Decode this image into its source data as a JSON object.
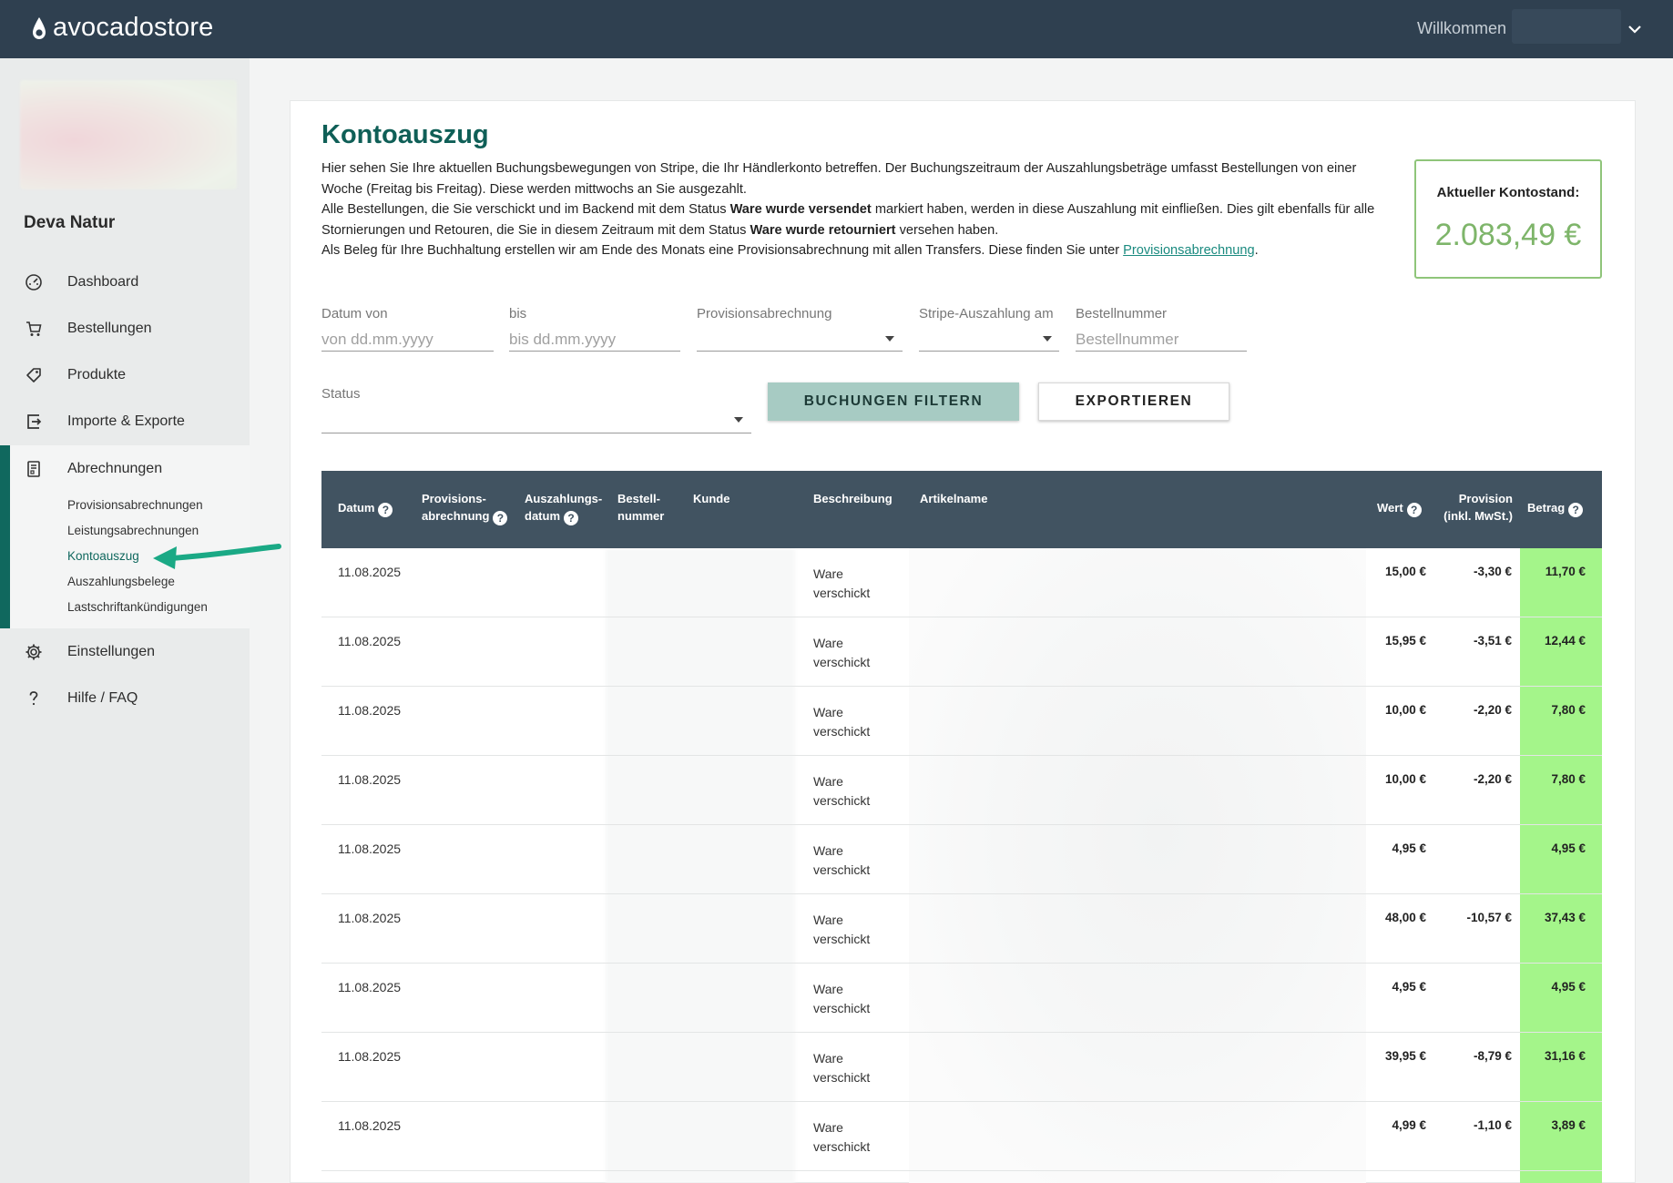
{
  "header": {
    "logo_text": "avocadostore",
    "welcome": "Willkommen"
  },
  "sidebar": {
    "shop_name": "Deva Natur",
    "items": [
      {
        "label": "Dashboard",
        "icon": "speedometer-icon"
      },
      {
        "label": "Bestellungen",
        "icon": "cart-icon"
      },
      {
        "label": "Produkte",
        "icon": "tag-icon"
      },
      {
        "label": "Importe & Exporte",
        "icon": "import-export-icon"
      },
      {
        "label": "Abrechnungen",
        "icon": "receipt-icon"
      },
      {
        "label": "Einstellungen",
        "icon": "gear-icon"
      },
      {
        "label": "Hilfe / FAQ",
        "icon": "question-icon"
      }
    ],
    "subitems": [
      {
        "label": "Provisionsabrechnungen"
      },
      {
        "label": "Leistungsabrechnungen"
      },
      {
        "label": "Kontoauszug",
        "active": true
      },
      {
        "label": "Auszahlungsbelege"
      },
      {
        "label": "Lastschriftankündigungen"
      }
    ],
    "accent_color": "#10685e"
  },
  "main": {
    "title": "Kontoauszug",
    "intro": {
      "l1": "Hier sehen Sie Ihre aktuellen Buchungsbewegungen von Stripe, die Ihr Händlerkonto betreffen. Der Buchungszeitraum der Auszahlungsbeträge umfasst Bestellungen von einer Woche (Freitag bis Freitag). Diese werden mittwochs an Sie ausgezahlt.",
      "l2_a": "Alle Bestellungen, die Sie verschickt und im Backend mit dem Status ",
      "l2_b": "Ware wurde versendet",
      "l2_c": " markiert haben, werden in diese Auszahlung mit einfließen. Dies gilt ebenfalls für alle Stornierungen und Retouren, die Sie in diesem Zeitraum mit dem Status ",
      "l2_d": "Ware wurde retourniert",
      "l2_e": " versehen haben.",
      "l3_a": "Als Beleg für Ihre Buchhaltung erstellen wir am Ende des Monats eine Provisionsabrechnung mit allen Transfers. Diese finden Sie unter ",
      "l3_link": "Provisionsabrechnung",
      "l3_end": "."
    },
    "balance": {
      "label": "Aktueller Kontostand:",
      "value": "2.083,49 €",
      "color": "#7eb56a"
    },
    "filters": {
      "date_from_label": "Datum von",
      "date_from_placeholder": "von dd.mm.yyyy",
      "date_to_label": "bis",
      "date_to_placeholder": "bis dd.mm.yyyy",
      "commission_label": "Provisionsabrechnung",
      "payout_label": "Stripe-Auszahlung am",
      "order_label": "Bestellnummer",
      "order_placeholder": "Bestellnummer",
      "status_label": "Status",
      "filter_button": "BUCHUNGEN FILTERN",
      "export_button": "EXPORTIEREN"
    },
    "table": {
      "headers": {
        "datum": "Datum",
        "provision_1": "Provisions-",
        "provision_2": "abrechnung",
        "auszahlung_1": "Auszahlungs-",
        "auszahlung_2": "datum",
        "bestell_1": "Bestell-",
        "bestell_2": "nummer",
        "kunde": "Kunde",
        "beschreibung": "Beschreibung",
        "artikel": "Artikelname",
        "wert": "Wert",
        "prov_incl_1": "Provision",
        "prov_incl_2": "(inkl. MwSt.)",
        "betrag": "Betrag"
      },
      "rows": [
        {
          "date": "11.08.2025",
          "desc1": "Ware",
          "desc2": "verschickt",
          "wert": "15,00 €",
          "prov": "-3,30 €",
          "betrag": "11,70 €"
        },
        {
          "date": "11.08.2025",
          "desc1": "Ware",
          "desc2": "verschickt",
          "wert": "15,95 €",
          "prov": "-3,51 €",
          "betrag": "12,44 €"
        },
        {
          "date": "11.08.2025",
          "desc1": "Ware",
          "desc2": "verschickt",
          "wert": "10,00 €",
          "prov": "-2,20 €",
          "betrag": "7,80 €"
        },
        {
          "date": "11.08.2025",
          "desc1": "Ware",
          "desc2": "verschickt",
          "wert": "10,00 €",
          "prov": "-2,20 €",
          "betrag": "7,80 €"
        },
        {
          "date": "11.08.2025",
          "desc1": "Ware",
          "desc2": "verschickt",
          "wert": "4,95 €",
          "prov": "",
          "betrag": "4,95 €"
        },
        {
          "date": "11.08.2025",
          "desc1": "Ware",
          "desc2": "verschickt",
          "wert": "48,00 €",
          "prov": "-10,57 €",
          "betrag": "37,43 €"
        },
        {
          "date": "11.08.2025",
          "desc1": "Ware",
          "desc2": "verschickt",
          "wert": "4,95 €",
          "prov": "",
          "betrag": "4,95 €"
        },
        {
          "date": "11.08.2025",
          "desc1": "Ware",
          "desc2": "verschickt",
          "wert": "39,95 €",
          "prov": "-8,79 €",
          "betrag": "31,16 €"
        },
        {
          "date": "11.08.2025",
          "desc1": "Ware",
          "desc2": "verschickt",
          "wert": "4,99 €",
          "prov": "-1,10 €",
          "betrag": "3,89 €"
        }
      ]
    }
  }
}
